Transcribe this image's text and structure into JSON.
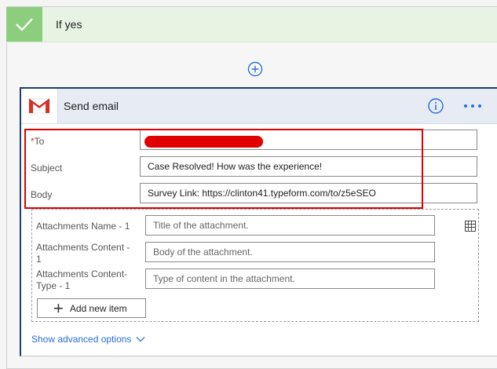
{
  "condition": {
    "branch_label": "If yes"
  },
  "action": {
    "title": "Send email",
    "fields": {
      "to": {
        "required_marker": "*",
        "label": "To"
      },
      "subject": {
        "label": "Subject",
        "value": "Case Resolved! How was the experience!"
      },
      "body": {
        "label": "Body",
        "value": "Survey Link: https://clinton41.typeform.com/to/z5eSEO"
      }
    },
    "attachments": {
      "name": {
        "label_line1": "Attachments Name - 1",
        "placeholder": "Title of the attachment."
      },
      "content": {
        "label_line1": "Attachments Content -",
        "label_line2": "1",
        "placeholder": "Body of the attachment."
      },
      "content_type": {
        "label_line1": "Attachments Content-",
        "label_line2": "Type - 1",
        "placeholder": "Type of content in the attachment."
      },
      "add_item_label": "Add new item"
    },
    "show_advanced_label": "Show advanced options"
  },
  "colors": {
    "accent_blue": "#2a6fdb",
    "highlight_red": "#e00000",
    "success_green": "#8cce7e",
    "card_border": "#1f3c73"
  }
}
